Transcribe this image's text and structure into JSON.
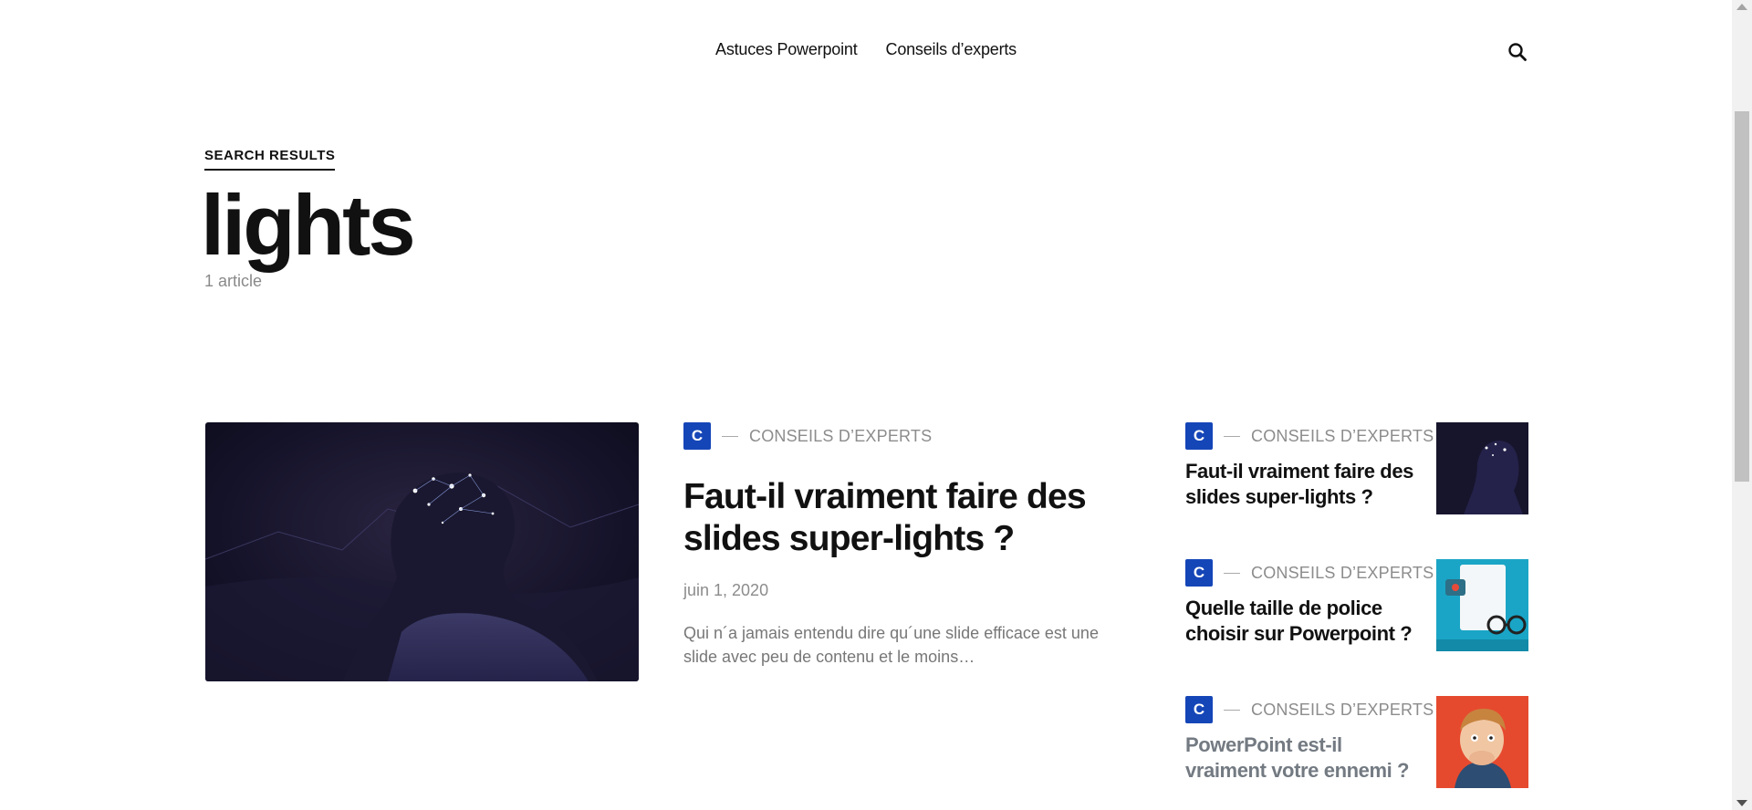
{
  "nav": {
    "items": [
      {
        "label": "Astuces Powerpoint"
      },
      {
        "label": "Conseils d’experts"
      }
    ]
  },
  "search": {
    "section_label": "SEARCH RESULTS",
    "query": "lights",
    "count": "1 article"
  },
  "main_article": {
    "category_badge": "C",
    "category": "CONSEILS D’EXPERTS",
    "title": "Faut-il vraiment faire des slides super-lights ?",
    "date": "juin 1, 2020",
    "excerpt": "Qui n´a jamais entendu dire qu´une slide efficace est une slide avec peu de contenu et le moins…"
  },
  "sidebar": {
    "items": [
      {
        "category_badge": "C",
        "category": "CONSEILS D’EXPERTS",
        "title": "Faut-il vraiment faire des slides super-lights ?"
      },
      {
        "category_badge": "C",
        "category": "CONSEILS D’EXPERTS",
        "title": "Quelle taille de police choisir sur Powerpoint ?"
      },
      {
        "category_badge": "C",
        "category": "CONSEILS D’EXPERTS",
        "title": "PowerPoint est-il vraiment votre ennemi ?"
      }
    ]
  },
  "colors": {
    "accent": "#1546b8",
    "text": "#111111",
    "muted": "#8c8c8c"
  },
  "icons": {
    "search": "search-icon"
  }
}
